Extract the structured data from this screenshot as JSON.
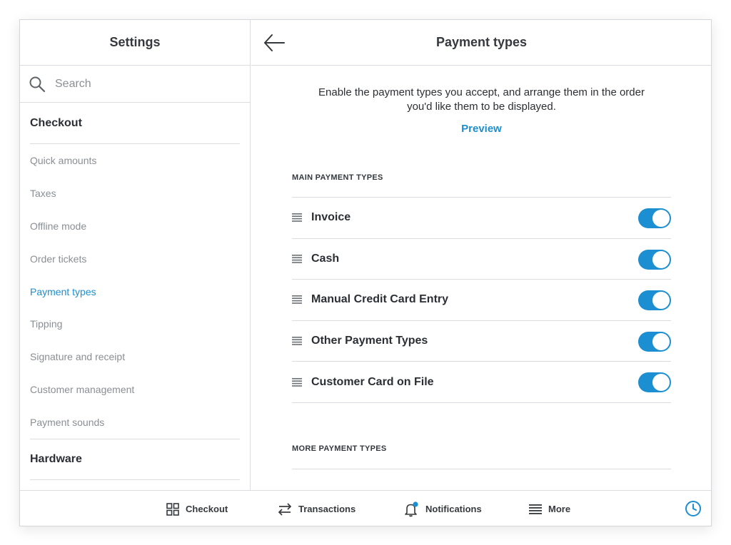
{
  "sidebar": {
    "title": "Settings",
    "search_placeholder": "Search",
    "section_checkout": "Checkout",
    "items": [
      {
        "label": "Quick amounts"
      },
      {
        "label": "Taxes"
      },
      {
        "label": "Offline mode"
      },
      {
        "label": "Order tickets"
      },
      {
        "label": "Payment types",
        "active": true
      },
      {
        "label": "Tipping"
      },
      {
        "label": "Signature and receipt"
      },
      {
        "label": "Customer management"
      },
      {
        "label": "Payment sounds"
      }
    ],
    "section_hardware": "Hardware"
  },
  "main": {
    "title": "Payment types",
    "intro_line1": "Enable the payment types you accept, and arrange them in the order",
    "intro_line2": "you'd like them to be displayed.",
    "preview_label": "Preview",
    "main_group_label": "MAIN PAYMENT TYPES",
    "payment_types": [
      {
        "label": "Invoice",
        "enabled": true
      },
      {
        "label": "Cash",
        "enabled": true
      },
      {
        "label": "Manual Credit Card Entry",
        "enabled": true
      },
      {
        "label": "Other Payment Types",
        "enabled": true
      },
      {
        "label": "Customer Card on File",
        "enabled": true
      }
    ],
    "more_group_label": "MORE PAYMENT TYPES"
  },
  "bottom_nav": {
    "checkout": "Checkout",
    "transactions": "Transactions",
    "notifications": "Notifications",
    "more": "More"
  },
  "colors": {
    "accent": "#1b8fd2",
    "muted_text": "#8a8f94",
    "divider": "#dadcdf"
  },
  "icons": {
    "search": "search-icon",
    "back": "arrow-left-icon",
    "drag": "drag-handle-icon",
    "checkout": "grid-icon",
    "transactions": "swap-arrows-icon",
    "notifications": "bell-icon",
    "more": "hamburger-icon",
    "clock": "clock-icon"
  }
}
